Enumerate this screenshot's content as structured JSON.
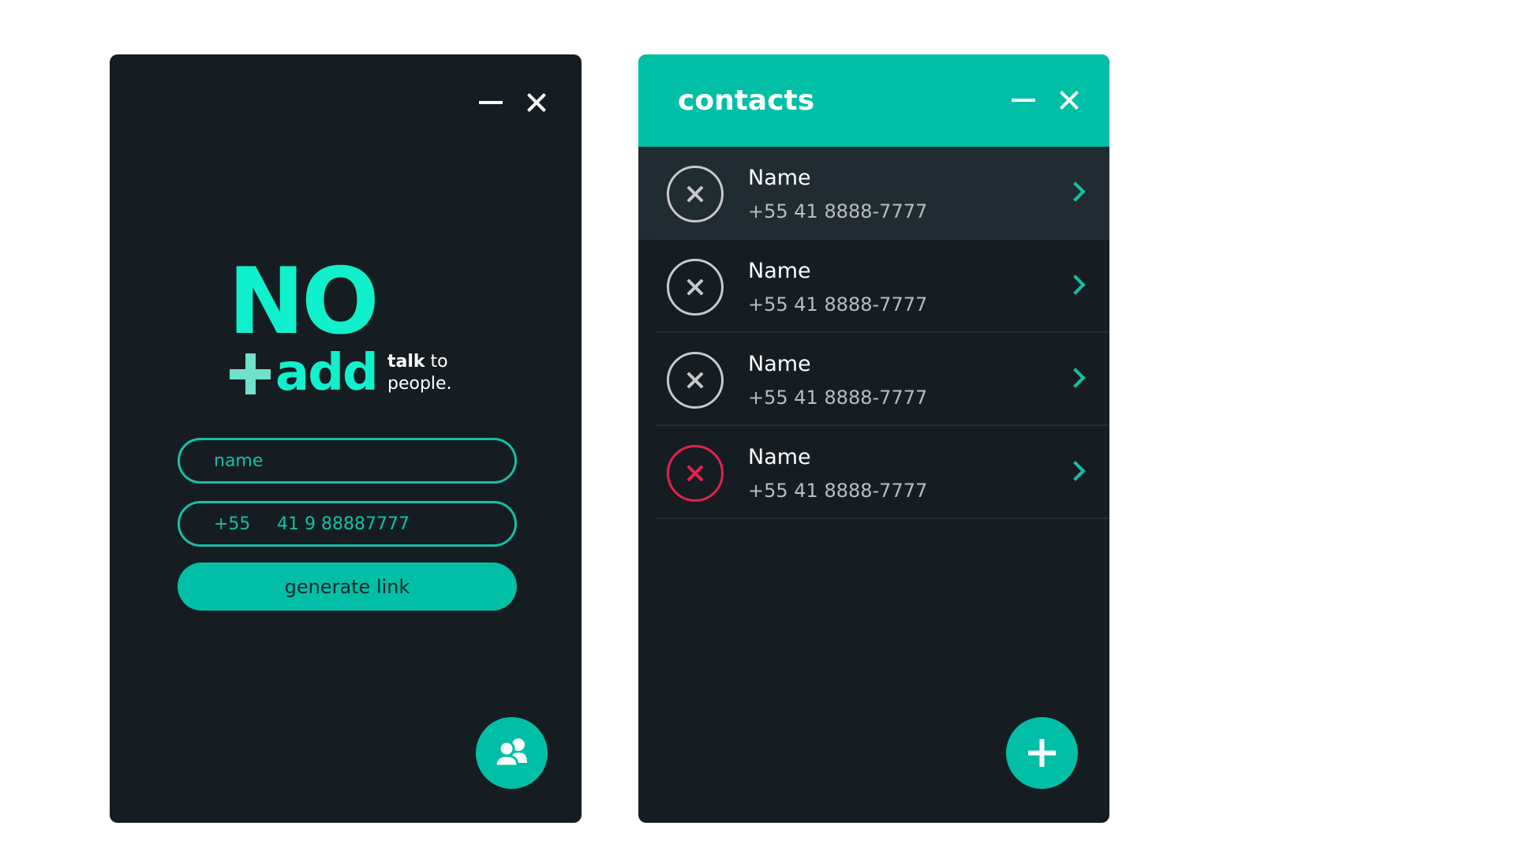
{
  "login_window": {
    "logo": {
      "brand_no": "NO",
      "brand_add": "add",
      "tagline_bold": "talk",
      "tagline_rest": " to",
      "tagline_line2": "people."
    },
    "name_field": {
      "placeholder": "name"
    },
    "phone_field": {
      "country_code": "+55",
      "number": "41 9 88887777"
    },
    "generate_button": "generate link",
    "fab_icon": "users-icon",
    "controls": {
      "minimize_icon": "minimize-icon",
      "close_icon": "close-icon"
    }
  },
  "contacts_window": {
    "title": "contacts",
    "controls": {
      "minimize_icon": "minimize-icon",
      "close_icon": "close-icon"
    },
    "contacts": [
      {
        "name": "Name",
        "phone": "+55 41 8888-7777",
        "selected": true,
        "danger": false
      },
      {
        "name": "Name",
        "phone": "+55 41 8888-7777",
        "selected": false,
        "danger": false
      },
      {
        "name": "Name",
        "phone": "+55 41 8888-7777",
        "selected": false,
        "danger": false
      },
      {
        "name": "Name",
        "phone": "+55 41 8888-7777",
        "selected": false,
        "danger": true
      }
    ],
    "fab_icon": "plus-icon"
  },
  "colors": {
    "accent": "#00bfa6",
    "logo": "#10f0cc",
    "window_bg": "#161d22",
    "selected_row": "#212c32",
    "danger": "#e6214f"
  }
}
